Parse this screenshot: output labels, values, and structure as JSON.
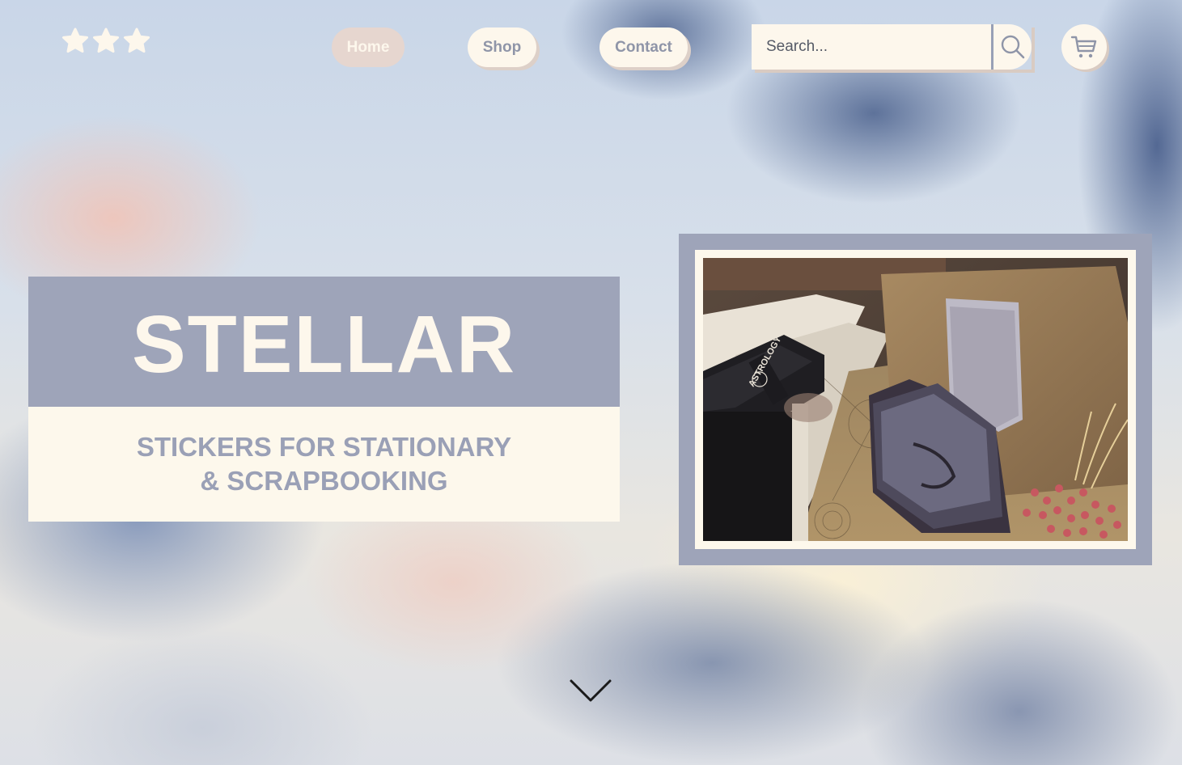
{
  "nav": {
    "home": "Home",
    "shop": "Shop",
    "contact": "Contact"
  },
  "search": {
    "placeholder": "Search..."
  },
  "hero": {
    "title": "STELLAR",
    "subtitle_line1": "STICKERS FOR STATIONARY",
    "subtitle_line2": "& SCRAPBOOKING"
  },
  "photo": {
    "book_spine_text": "ASTROLOGY"
  },
  "icons": {
    "logo": "three-stars-icon",
    "search": "search-icon",
    "cart": "cart-icon",
    "scroll": "chevron-down-icon"
  },
  "colors": {
    "slate": "#9ea4b9",
    "cream": "#fdf8ec",
    "rose": "#e6d6cf",
    "nav_text": "#8f95a8"
  }
}
